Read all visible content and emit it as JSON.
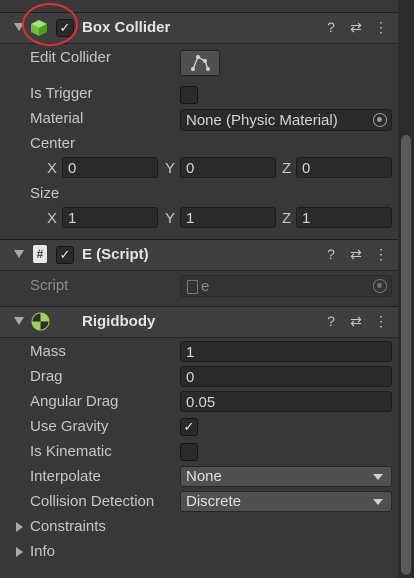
{
  "box_collider": {
    "title": "Box Collider",
    "edit_collider_label": "Edit Collider",
    "is_trigger_label": "Is Trigger",
    "material_label": "Material",
    "material_value": "None (Physic Material)",
    "center_label": "Center",
    "center": {
      "x_label": "X",
      "x": "0",
      "y_label": "Y",
      "y": "0",
      "z_label": "Z",
      "z": "0"
    },
    "size_label": "Size",
    "size": {
      "x_label": "X",
      "x": "1",
      "y_label": "Y",
      "y": "1",
      "z_label": "Z",
      "z": "1"
    }
  },
  "e_script": {
    "title": "E (Script)",
    "script_label": "Script",
    "script_value": "e"
  },
  "rigidbody": {
    "title": "Rigidbody",
    "mass_label": "Mass",
    "mass": "1",
    "drag_label": "Drag",
    "drag": "0",
    "angular_drag_label": "Angular Drag",
    "angular_drag": "0.05",
    "use_gravity_label": "Use Gravity",
    "is_kinematic_label": "Is Kinematic",
    "interpolate_label": "Interpolate",
    "interpolate": "None",
    "collision_detection_label": "Collision Detection",
    "collision_detection": "Discrete",
    "constraints_label": "Constraints",
    "info_label": "Info"
  },
  "colors": {
    "panel": "#383838",
    "header": "#3e3e3e",
    "highlight_circle": "#e03030",
    "collider_icon": "#7fd24a"
  },
  "icons": [
    "help-icon",
    "preset-icon",
    "more-icon",
    "edit-collider-icon",
    "object-picker-icon",
    "script-file-icon",
    "rigidbody-icon",
    "box-collider-icon",
    "checkmark-icon"
  ]
}
